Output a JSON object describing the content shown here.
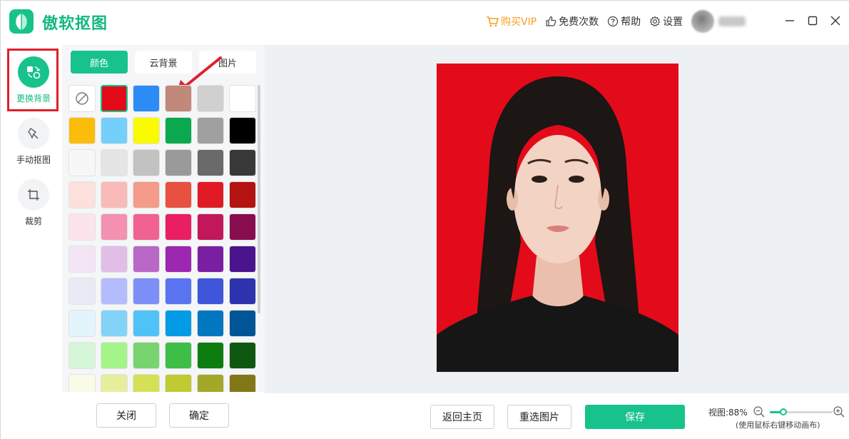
{
  "app": {
    "name": "傲软抠图"
  },
  "header": {
    "vip_label": "购买VIP",
    "free_count_label": "免费次数",
    "help_label": "帮助",
    "settings_label": "设置"
  },
  "rail": {
    "tools": [
      {
        "label": "更换背景",
        "icon": "swap-background-icon",
        "active": true
      },
      {
        "label": "手动抠图",
        "icon": "brush-icon",
        "active": false
      },
      {
        "label": "裁剪",
        "icon": "crop-icon",
        "active": false
      }
    ]
  },
  "panel": {
    "tabs": [
      {
        "label": "颜色",
        "active": true
      },
      {
        "label": "云背景",
        "active": false
      },
      {
        "label": "图片",
        "active": false
      }
    ],
    "selected_color": "#e30b19",
    "swatches": [
      [
        "none",
        "#e30b19",
        "#2b8cf6",
        "#c0897a",
        "#d0d0d0",
        "#ffffff"
      ],
      [
        "#fbbd0b",
        "#74cffb",
        "#fbfb00",
        "#0aa94f",
        "#a0a0a0",
        "#000000"
      ],
      [
        "#f7f7f7",
        "#e5e5e5",
        "#c2c2c2",
        "#9a9a9a",
        "#6a6a6a",
        "#383838"
      ],
      [
        "#fde0dc",
        "#f8bbb9",
        "#f59b8a",
        "#e8503f",
        "#e01b24",
        "#b3140f"
      ],
      [
        "#fce4ec",
        "#f491b1",
        "#f06292",
        "#e91e63",
        "#c2185b",
        "#880e4f"
      ],
      [
        "#f3e5f5",
        "#e1bee7",
        "#ba68c8",
        "#9c27b0",
        "#7b1fa2",
        "#4a148c"
      ],
      [
        "#e8eaf6",
        "#b4bcfc",
        "#7b8ff6",
        "#5a73f0",
        "#3f56da",
        "#2e34b0"
      ],
      [
        "#e3f4fd",
        "#83d2f8",
        "#4fc3f7",
        "#039be5",
        "#0077c0",
        "#005597"
      ],
      [
        "#d5f5d8",
        "#a3f58a",
        "#78d46f",
        "#3ebd47",
        "#0d7d0f",
        "#0f5810"
      ],
      [
        "#f9fbe7",
        "#e6ee9c",
        "#d4e157",
        "#c0ca33",
        "#a4a828",
        "#827717"
      ]
    ],
    "close_label": "关闭",
    "confirm_label": "确定"
  },
  "bottom": {
    "home_label": "返回主页",
    "reselect_label": "重选图片",
    "save_label": "保存",
    "zoom_label": "视图:88%",
    "zoom_percent": 88,
    "zoom_hint": "(使用鼠标右键移动画布)"
  },
  "colors": {
    "brand": "#17c28b",
    "vip": "#f5a020",
    "photo_background": "#e30b19",
    "annotation": "#e0202a"
  }
}
